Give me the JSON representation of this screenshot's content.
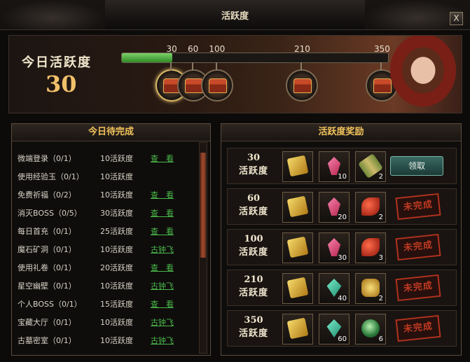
{
  "window": {
    "title": "活跃度",
    "close_label": "X"
  },
  "banner": {
    "label": "今日活跃度",
    "value": "30",
    "progress": {
      "current": 30,
      "max": 350
    },
    "milestones": [
      "30",
      "60",
      "100",
      "210",
      "350"
    ]
  },
  "left_panel": {
    "title": "今日待完成",
    "tasks": [
      {
        "name": "微端登录",
        "progress": "（0/1）",
        "reward": "10活跃度",
        "action": "查　看"
      },
      {
        "name": "使用经验玉",
        "progress": "（0/1）",
        "reward": "10活跃度",
        "action": ""
      },
      {
        "name": "免费祈福",
        "progress": "（0/2）",
        "reward": "10活跃度",
        "action": "查　看"
      },
      {
        "name": "消灭BOSS",
        "progress": "（0/5）",
        "reward": "30活跃度",
        "action": "查　看"
      },
      {
        "name": "每日首充",
        "progress": "（0/1）",
        "reward": "25活跃度",
        "action": "查　看"
      },
      {
        "name": "魔石矿洞",
        "progress": "（0/1）",
        "reward": "10活跃度",
        "action": "古钟飞"
      },
      {
        "name": "使用礼卷",
        "progress": "（0/1）",
        "reward": "20活跃度",
        "action": "查　看"
      },
      {
        "name": "星空幽壁",
        "progress": "（0/1）",
        "reward": "10活跃度",
        "action": "古钟飞"
      },
      {
        "name": "个人BOSS",
        "progress": "（0/1）",
        "reward": "15活跃度",
        "action": "查　看"
      },
      {
        "name": "宝藏大厅",
        "progress": "（0/1）",
        "reward": "10活跃度",
        "action": "古钟飞"
      },
      {
        "name": "古墓密室",
        "progress": "（0/1）",
        "reward": "10活跃度",
        "action": "古钟飞"
      }
    ]
  },
  "right_panel": {
    "title": "活跃度奖励",
    "rows_label": "活跃度",
    "rows": [
      {
        "level": "30",
        "items": [
          {
            "icon": "gold-ticket-icon",
            "qty": ""
          },
          {
            "icon": "pink-crystal-icon",
            "qty": "10"
          },
          {
            "icon": "scroll-icon",
            "qty": "2"
          }
        ],
        "status": "领取",
        "claimable": true
      },
      {
        "level": "60",
        "items": [
          {
            "icon": "gold-ticket-icon",
            "qty": ""
          },
          {
            "icon": "pink-crystal-icon",
            "qty": "20"
          },
          {
            "icon": "red-gem-icon",
            "qty": "2"
          }
        ],
        "status": "未完成",
        "claimable": false
      },
      {
        "level": "100",
        "items": [
          {
            "icon": "gold-ticket-icon",
            "qty": ""
          },
          {
            "icon": "pink-crystal-icon",
            "qty": "30"
          },
          {
            "icon": "red-gem-icon",
            "qty": "3"
          }
        ],
        "status": "未完成",
        "claimable": false
      },
      {
        "level": "210",
        "items": [
          {
            "icon": "gold-ticket-icon",
            "qty": ""
          },
          {
            "icon": "teal-crystal-icon",
            "qty": "40"
          },
          {
            "icon": "lantern-icon",
            "qty": "2"
          }
        ],
        "status": "未完成",
        "claimable": false
      },
      {
        "level": "350",
        "items": [
          {
            "icon": "gold-ticket-icon",
            "qty": ""
          },
          {
            "icon": "teal-crystal-icon",
            "qty": "60"
          },
          {
            "icon": "green-orb-icon",
            "qty": "6"
          }
        ],
        "status": "未完成",
        "claimable": false
      }
    ]
  },
  "colors": {
    "accent_gold": "#f2c35c",
    "link_green": "#4ab94a",
    "stamp_red": "#c23a22"
  }
}
